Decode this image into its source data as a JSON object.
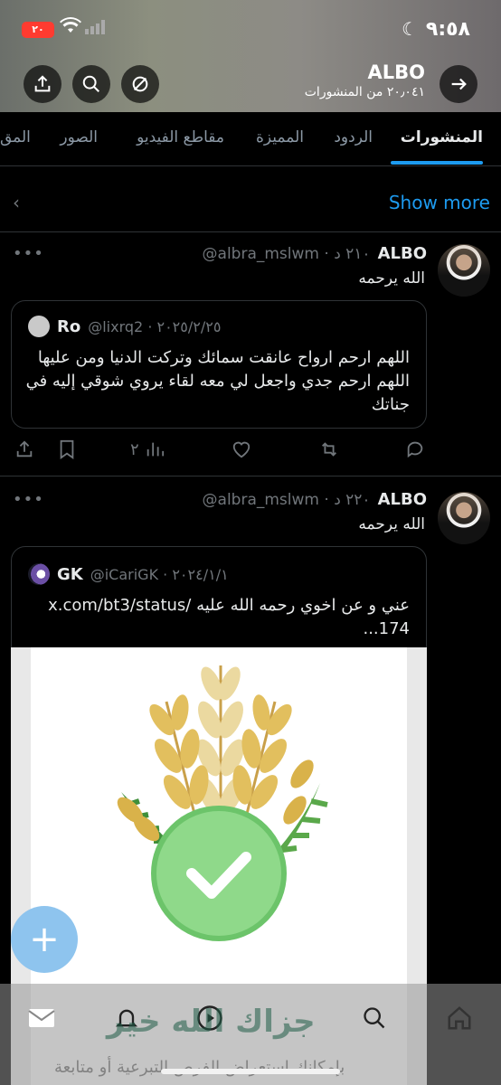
{
  "status_bar": {
    "time": "٩:٥٨",
    "battery": "٢٠"
  },
  "header": {
    "name": "ALBO",
    "post_count": "٢٠٫٠٤١ من المنشورات"
  },
  "tabs": [
    "المنشورات",
    "الردود",
    "المميزة",
    "مقاطع الفيديو",
    "الصور",
    "المق"
  ],
  "show_more": "Show more",
  "posts": [
    {
      "name": "ALBO",
      "handle": "@albra_mslwm · ٢١٠ د",
      "text": "الله يرحمه",
      "quote": {
        "name": "Ro",
        "handle": "@lixrq2 · ٢٠٢٥/٢/٢٥",
        "text_lines": [
          "اللهم ارحم ارواح عانقت سمائك وتركت الدنيا ومن عليها",
          "اللهم ارحم جدي واجعل لي معه لقاء يروي شوقي إليه في",
          "جناتك"
        ]
      },
      "views": "٢"
    },
    {
      "name": "ALBO",
      "handle": "@albra_mslwm · ٢٢٠ د",
      "text": "الله يرحمه",
      "quote": {
        "name": "GK",
        "handle": "@iCariGK · ٢٠٢٤/١/١",
        "text_lines": [
          "عني و عن اخوي رحمه الله عليه /x.com/bt3/status",
          "174..."
        ]
      }
    }
  ],
  "image_overlay": {
    "title": "جزاك الله خير",
    "subtitle": "بإمكانك استعراض الفرص التبرعية أو متابعة"
  },
  "colors": {
    "accent": "#1d9bf0",
    "check_green": "#8fd98a",
    "wheat": "#e8c46a"
  },
  "icons": [
    "share-icon",
    "search-icon",
    "mute-icon",
    "back-arrow-icon",
    "reply-icon",
    "retweet-icon",
    "like-icon",
    "views-icon",
    "bookmark-icon",
    "mail-icon",
    "bell-icon",
    "home-icon",
    "compose-icon"
  ]
}
